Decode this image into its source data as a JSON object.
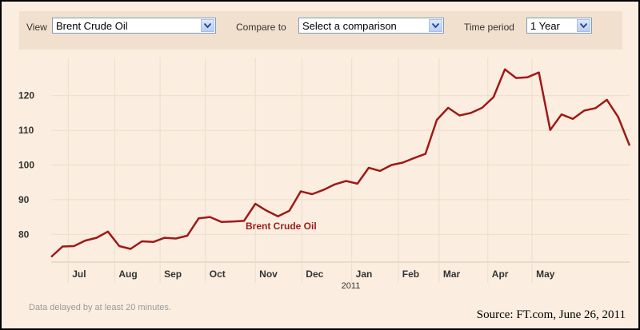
{
  "toolbar": {
    "view_label": "View",
    "view_value": "Brent Crude Oil",
    "compare_label": "Compare to",
    "compare_value": "Select a comparison",
    "period_label": "Time period",
    "period_value": "1 Year"
  },
  "footer": {
    "delay_note": "Data delayed by at least 20 minutes.",
    "source": "Source: FT.com, June 26, 2011"
  },
  "colors": {
    "line": "#a01818",
    "background": "#fbeee0",
    "toolbar": "#f2e0cf",
    "grid": "#ecdccb"
  },
  "chart_data": {
    "type": "line",
    "title": "",
    "xlabel": "",
    "ylabel": "",
    "ylim": [
      72,
      131
    ],
    "yticks": [
      80,
      90,
      100,
      110,
      120
    ],
    "months": [
      {
        "label": "Jul",
        "sub": "",
        "pos": 1.5
      },
      {
        "label": "Aug",
        "sub": "",
        "pos": 5.6
      },
      {
        "label": "Sep",
        "sub": "",
        "pos": 9.6
      },
      {
        "label": "Oct",
        "sub": "",
        "pos": 13.6
      },
      {
        "label": "Nov",
        "sub": "",
        "pos": 18.0
      },
      {
        "label": "Dec",
        "sub": "",
        "pos": 22.1
      },
      {
        "label": "Jan",
        "sub": "2011",
        "pos": 26.5
      },
      {
        "label": "Feb",
        "sub": "",
        "pos": 30.6
      },
      {
        "label": "Mar",
        "sub": "",
        "pos": 34.2
      },
      {
        "label": "Apr",
        "sub": "",
        "pos": 38.5
      },
      {
        "label": "May",
        "sub": "",
        "pos": 42.4
      }
    ],
    "series": [
      {
        "name": "Brent Crude Oil",
        "values": [
          73.5,
          76.5,
          76.6,
          78.2,
          79.0,
          80.8,
          76.6,
          75.8,
          78.0,
          77.8,
          79.0,
          78.8,
          79.6,
          84.6,
          85.0,
          83.6,
          83.7,
          83.9,
          88.8,
          86.8,
          85.2,
          86.8,
          92.4,
          91.6,
          92.8,
          94.4,
          95.4,
          94.6,
          99.2,
          98.3,
          100.0,
          100.7,
          102.0,
          103.2,
          113.0,
          116.5,
          114.3,
          115.0,
          116.5,
          119.6,
          127.6,
          125.1,
          125.3,
          126.7,
          110.1,
          114.6,
          113.3,
          115.7,
          116.4,
          118.8,
          113.8,
          105.6
        ]
      }
    ],
    "series_label_text": "Brent Crude Oil"
  }
}
